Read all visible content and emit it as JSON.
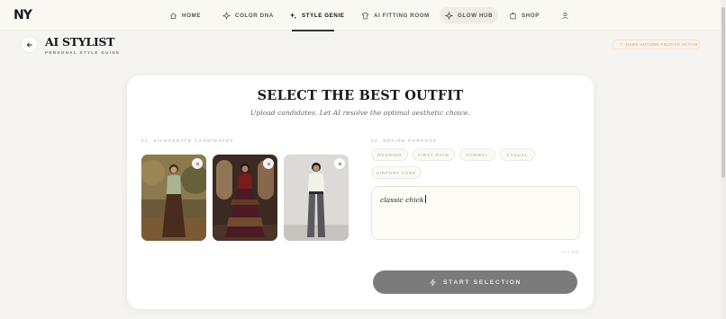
{
  "brand": {
    "logo": "NY"
  },
  "nav": {
    "items": [
      {
        "label": "HOME",
        "icon": "home-icon"
      },
      {
        "label": "COLOR DNA",
        "icon": "sparkle-icon"
      },
      {
        "label": "STYLE GENIE",
        "icon": "sparkles-icon",
        "active": true
      },
      {
        "label": "AI FITTING ROOM",
        "icon": "shirt-icon"
      },
      {
        "label": "GLOW HUB",
        "icon": "glow-icon"
      },
      {
        "label": "SHOP",
        "icon": "shopping-bag-icon"
      }
    ],
    "profile_icon": "user-icon"
  },
  "header": {
    "title": "AI STYLIST",
    "subtitle": "PERSONAL STYLE GUIDE",
    "profile_chip": "DARK AUTUMN PROFILE ACTIVE"
  },
  "card": {
    "title": "SELECT THE BEST OUTFIT",
    "subtitle": "Upload candidates. Let AI resolve the optimal aesthetic choice.",
    "candidates_label": "01. SILHOUETTE CANDIDATES",
    "purpose_label": "02. DEFINE PURPOSE",
    "purposes": [
      "WEDDING",
      "FIRST DATE",
      "FORMAL",
      "CASUAL",
      "AIRPORT LOOK"
    ],
    "purpose_input": {
      "value": "classic chick"
    },
    "char_count": "13 / 500",
    "start_button": "START SELECTION"
  },
  "colors": {
    "accent": "#e2b48c",
    "button_bg": "#7b7b7b",
    "card_bg": "#ffffff",
    "page_bg": "#f5f4f1"
  }
}
